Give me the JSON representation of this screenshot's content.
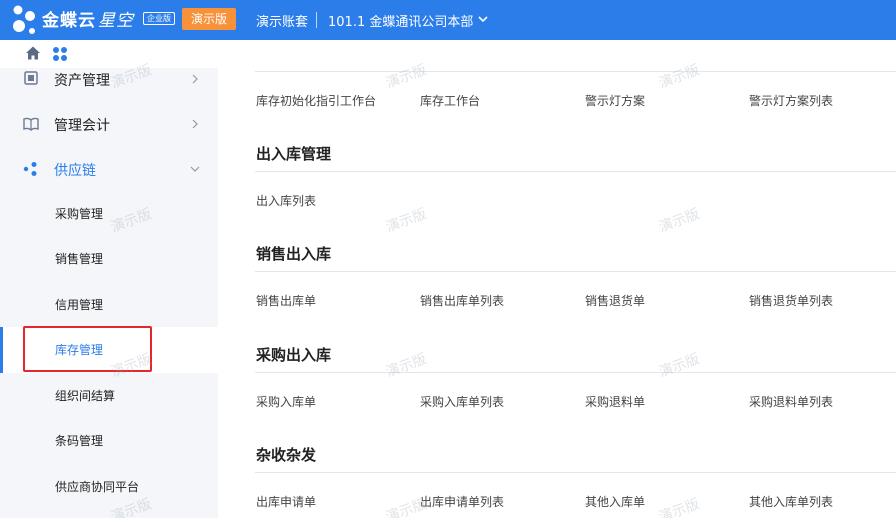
{
  "header": {
    "brand_main": "金蝶云",
    "brand_sub": "星空",
    "edition_badge": "企业版",
    "demo_badge": "演示版",
    "account_label": "演示账套",
    "org_name": "101.1 金蝶通讯公司本部"
  },
  "sidebar": {
    "top_items": [
      {
        "label": "资产管理",
        "icon": "asset-icon"
      },
      {
        "label": "管理会计",
        "icon": "book-icon"
      },
      {
        "label": "供应链",
        "icon": "supply-chain-icon"
      }
    ],
    "sub_items": [
      {
        "label": "采购管理"
      },
      {
        "label": "销售管理"
      },
      {
        "label": "信用管理"
      },
      {
        "label": "库存管理"
      },
      {
        "label": "组织间结算"
      },
      {
        "label": "条码管理"
      },
      {
        "label": "供应商协同平台"
      }
    ],
    "selected": "库存管理"
  },
  "content": {
    "top_links": [
      "库存初始化指引工作台",
      "库存工作台",
      "警示灯方案",
      "警示灯方案列表"
    ],
    "sections": [
      {
        "title": "出入库管理",
        "links": [
          "出入库列表"
        ]
      },
      {
        "title": "销售出入库",
        "links": [
          "销售出库单",
          "销售出库单列表",
          "销售退货单",
          "销售退货单列表"
        ]
      },
      {
        "title": "采购出入库",
        "links": [
          "采购入库单",
          "采购入库单列表",
          "采购退料单",
          "采购退料单列表"
        ]
      },
      {
        "title": "杂收杂发",
        "links": [
          "出库申请单",
          "出库申请单列表",
          "其他入库单",
          "其他入库单列表"
        ]
      }
    ]
  },
  "watermark": "演示版",
  "colors": {
    "primary": "#2b7de9",
    "demo_orange": "#f7923a",
    "highlight_red": "#e5262b",
    "sidebar_bg": "#f4f6f9"
  }
}
